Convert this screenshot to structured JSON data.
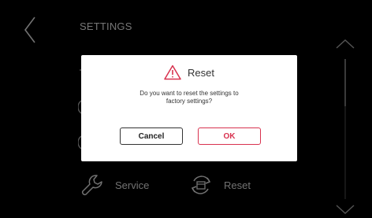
{
  "header": {
    "title": "SETTINGS"
  },
  "menu": {
    "service_label": "Service",
    "reset_label": "Reset"
  },
  "dialog": {
    "title": "Reset",
    "message_line1": "Do you want to reset the settings to",
    "message_line2": "factory settings?",
    "cancel_label": "Cancel",
    "ok_label": "OK"
  },
  "colors": {
    "accent": "#d8324f",
    "background": "#000000",
    "dialog_bg": "#ffffff",
    "text_light": "#d7d7d7"
  },
  "icons": {
    "back": "chevron-left-icon",
    "scroll_up": "chevron-up-icon",
    "scroll_down": "chevron-down-icon",
    "service": "wrench-icon",
    "reset": "reset-icon",
    "warning": "warning-icon"
  }
}
